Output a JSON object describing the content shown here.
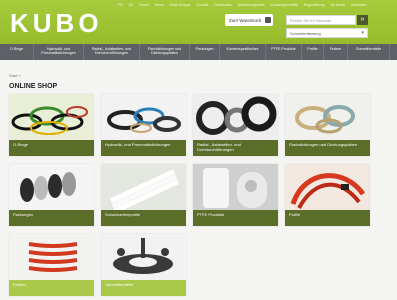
{
  "brand": {
    "logo_text": "KUBO"
  },
  "header": {
    "top_links": [
      "FR",
      "DE",
      "Home",
      "News",
      "Kubo Gruppe",
      "Kontakt",
      "Downloads",
      "Anmeldungsseite",
      "Kundengeschäfte",
      "Registrierung",
      "Ihr Konto",
      "Anmelden"
    ],
    "cart_label": "Zum Warenkorb",
    "search_placeholder": "Finden Sie Ihr Nummer",
    "search_button": "»",
    "quick_select": "Schnellerfassung",
    "quick_chevron": "▾"
  },
  "nav": {
    "items": [
      "O-Ringe",
      "Hydraulik- und Pneumatikdichtungen",
      "Radial-, Axialwellen- und Drehdurchführungen",
      "Flachdichtungen und Dichtungsplatten",
      "Packungen",
      "Kundenspezifisches",
      "PTFE Produkte",
      "Profile",
      "Federn",
      "Gummiformteile"
    ]
  },
  "breadcrumb": "Start »",
  "page_title": "ONLINE SHOP",
  "tiles": [
    {
      "label": "O-Ringe"
    },
    {
      "label": "Hydraulik- und Pneumatikdichtungen"
    },
    {
      "label": "Radial-, Axialwellen- und Drehdurchführungen"
    },
    {
      "label": "Flachdichtungen und Dichtungsplatten"
    },
    {
      "label": "Packungen"
    },
    {
      "label": "Schutzkantenprofile"
    },
    {
      "label": "PTFE Produkte"
    },
    {
      "label": "Profile"
    },
    {
      "label": "Federn"
    },
    {
      "label": "Gummiformteile"
    }
  ],
  "colors": {
    "brand_green": "#9fc536",
    "nav_gray": "#5d6064",
    "label_green": "#5a6e2a",
    "label_light": "#aac84a"
  }
}
